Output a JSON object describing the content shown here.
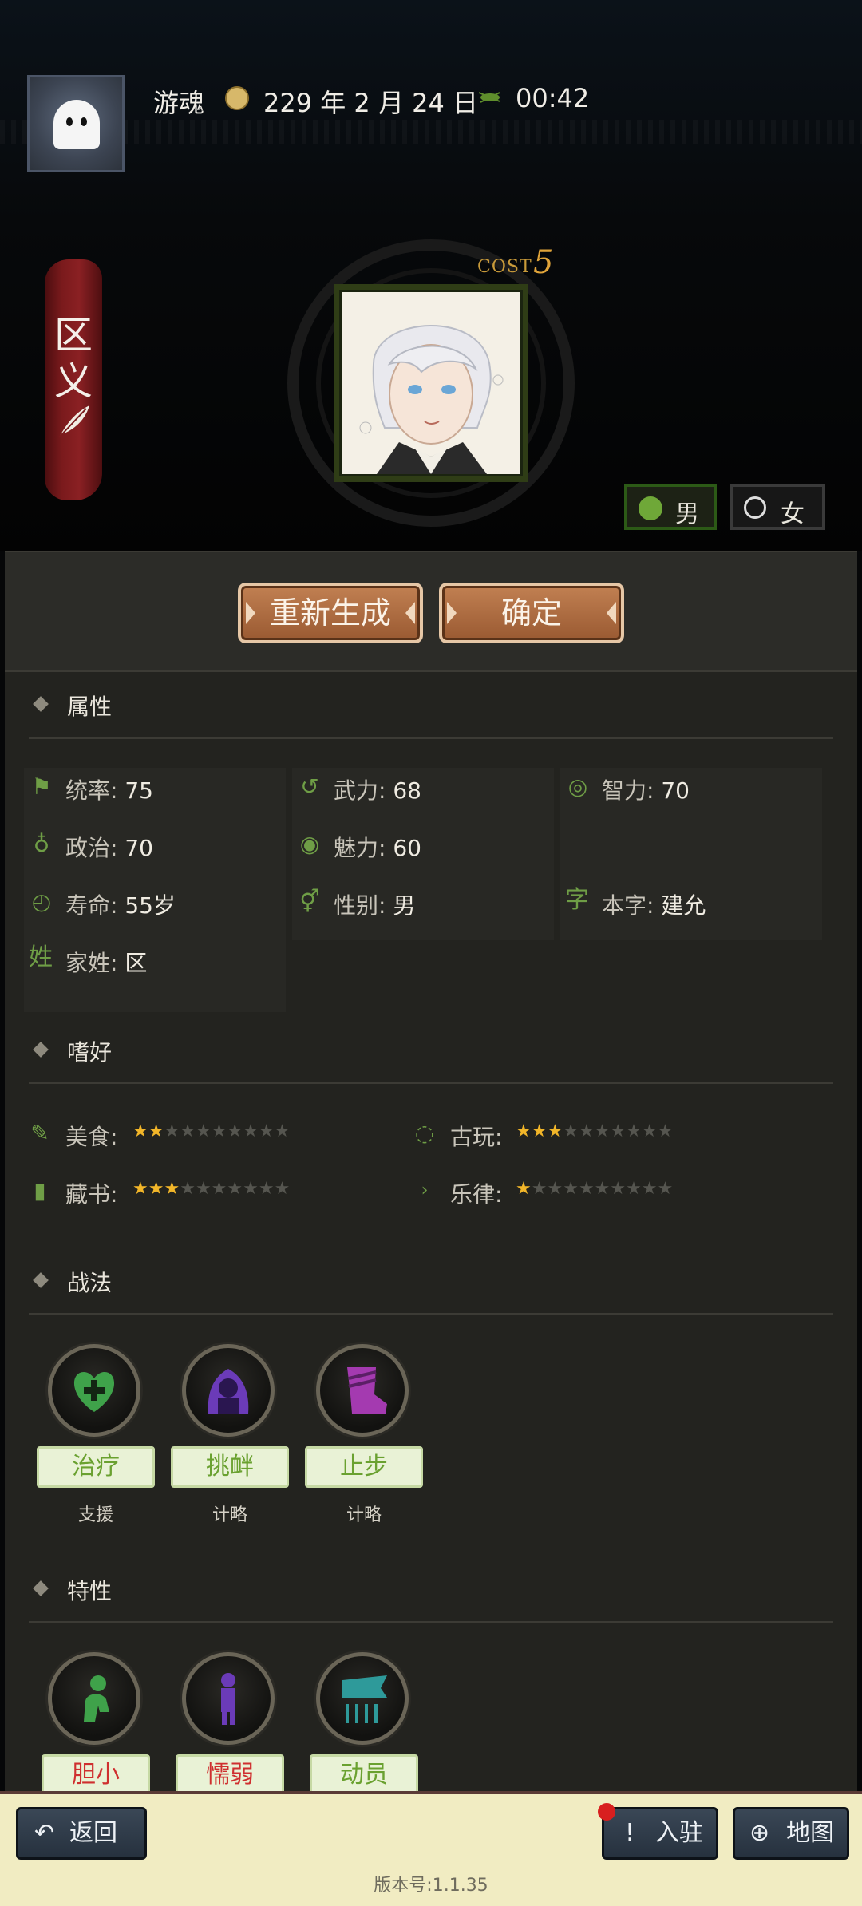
{
  "header": {
    "player_name": "游魂",
    "date": "229 年 2 月 24 日",
    "time": "00:42"
  },
  "character": {
    "name_chars": [
      "区",
      "义"
    ],
    "cost_label": "COST",
    "cost_value": "5"
  },
  "gender": {
    "male_label": "男",
    "female_label": "女",
    "selected": "男"
  },
  "actions": {
    "regenerate": "重新生成",
    "confirm": "确定"
  },
  "attributes": {
    "title": "属性",
    "items": [
      {
        "label": "统率:",
        "value": "75",
        "icon": "flag-icon"
      },
      {
        "label": "武力:",
        "value": "68",
        "icon": "arm-icon"
      },
      {
        "label": "智力:",
        "value": "70",
        "icon": "brain-icon"
      },
      {
        "label": "政治:",
        "value": "70",
        "icon": "pouch-icon"
      },
      {
        "label": "魅力:",
        "value": "60",
        "icon": "eye-icon"
      },
      {
        "label": "寿命:",
        "value": "55岁",
        "icon": "clock-icon"
      },
      {
        "label": "性别:",
        "value": "男",
        "icon": "gender-icon"
      },
      {
        "label": "本字:",
        "value": "建允",
        "icon": "字"
      },
      {
        "label": "家姓:",
        "value": "区",
        "icon": "姓"
      }
    ]
  },
  "hobbies": {
    "title": "嗜好",
    "items": [
      {
        "label": "美食:",
        "stars_on": 1.5,
        "stars_total": 10,
        "icon": "food-icon"
      },
      {
        "label": "古玩:",
        "stars_on": 2.5,
        "stars_total": 10,
        "icon": "antique-icon"
      },
      {
        "label": "藏书:",
        "stars_on": 3,
        "stars_total": 10,
        "icon": "book-icon"
      },
      {
        "label": "乐律:",
        "stars_on": 1,
        "stars_total": 10,
        "icon": "music-icon"
      }
    ]
  },
  "tactics": {
    "title": "战法",
    "items": [
      {
        "name": "治疗",
        "type": "支援",
        "icon": "heal-heart-icon",
        "color": "#3fa24a"
      },
      {
        "name": "挑衅",
        "type": "计略",
        "icon": "provoke-icon",
        "color": "#7b3fc6"
      },
      {
        "name": "止步",
        "type": "计略",
        "icon": "boot-icon",
        "color": "#a43ab0"
      }
    ]
  },
  "traits": {
    "title": "特性",
    "items": [
      {
        "name": "胆小",
        "icon": "kneel-icon",
        "color": "red"
      },
      {
        "name": "懦弱",
        "icon": "weak-figure-icon",
        "color": "red"
      },
      {
        "name": "动员",
        "icon": "banner-arrows-icon",
        "color": "green"
      }
    ]
  },
  "bottom": {
    "back": "返回",
    "enter": "入驻",
    "map": "地图",
    "version": "版本号:1.1.35"
  },
  "colors": {
    "accent_green": "#6fa838",
    "button_brown": "#b06f44",
    "banner_red": "#7a1a1c",
    "panel": "#23231f"
  }
}
